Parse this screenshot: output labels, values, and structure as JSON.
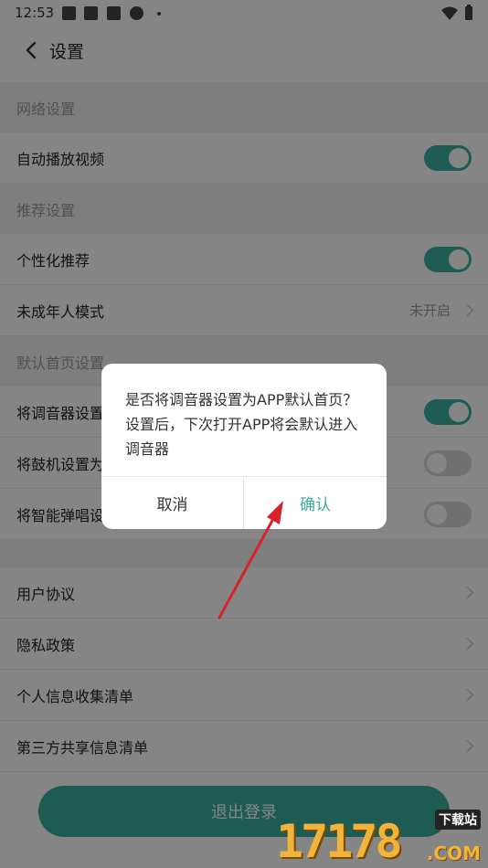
{
  "status_bar": {
    "time": "12:53"
  },
  "header": {
    "title": "设置"
  },
  "sections": [
    {
      "title": "网络设置",
      "rows": [
        {
          "label": "自动播放视频",
          "toggle": "on"
        }
      ]
    },
    {
      "title": "推荐设置",
      "rows": [
        {
          "label": "个性化推荐",
          "toggle": "on"
        },
        {
          "label": "未成年人模式",
          "value": "未开启"
        }
      ]
    },
    {
      "title": "默认首页设置",
      "rows": [
        {
          "label": "将调音器设置",
          "toggle": "on"
        },
        {
          "label": "将鼓机设置为",
          "toggle": "off"
        },
        {
          "label": "将智能弹唱设",
          "toggle": "off"
        }
      ]
    }
  ],
  "links": [
    "用户协议",
    "隐私政策",
    "个人信息收集清单",
    "第三方共享信息清单"
  ],
  "logout_label": "退出登录",
  "dialog": {
    "message": "是否将调音器设置为APP默认首页？设置后，下次打开APP将会默认进入调音器",
    "cancel_label": "取消",
    "confirm_label": "确认"
  },
  "watermark": {
    "number": "17178",
    "site_label": "下载站",
    "suffix": ".COM"
  },
  "colors": {
    "accent": "#3aaea0",
    "overlay": "rgba(0,0,0,0.48)",
    "annotation_arrow": "#d8232a"
  },
  "icons": {
    "back": "chevron-left-icon",
    "wifi": "wifi-icon",
    "battery": "battery-icon"
  }
}
